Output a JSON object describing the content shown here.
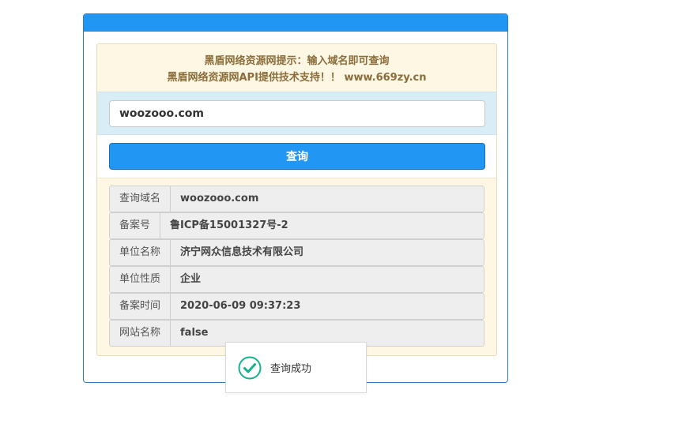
{
  "notice": {
    "line1": "黑盾网络资源网提示：输入域名即可查询",
    "line2": "黑盾网络资源网API提供技术支持！！ www.669zy.cn"
  },
  "search": {
    "value": "woozooo.com"
  },
  "query_button": {
    "label": "查询"
  },
  "results": [
    {
      "label": "查询域名",
      "value": "woozooo.com"
    },
    {
      "label": "备案号",
      "value": "鲁ICP备15001327号-2"
    },
    {
      "label": "单位名称",
      "value": "济宁网众信息技术有限公司"
    },
    {
      "label": "单位性质",
      "value": "企业"
    },
    {
      "label": "备案时间",
      "value": "2020-06-09 09:37:23"
    },
    {
      "label": "网站名称",
      "value": "false"
    }
  ],
  "toast": {
    "icon": "check-circle-icon",
    "text": "查询成功"
  },
  "colors": {
    "primary": "#2196f3",
    "notice_text": "#8a6d3b",
    "success": "#16b28e"
  }
}
